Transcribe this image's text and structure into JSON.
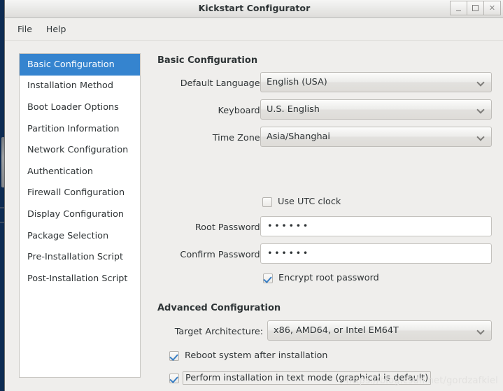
{
  "window": {
    "title": "Kickstart Configurator",
    "buttons": {
      "minimize": "_",
      "maximize": "□",
      "close": "✕"
    }
  },
  "menubar": {
    "items": [
      {
        "label": "File"
      },
      {
        "label": "Help"
      }
    ]
  },
  "sidebar": {
    "items": [
      {
        "label": "Basic Configuration",
        "selected": true
      },
      {
        "label": "Installation Method",
        "selected": false
      },
      {
        "label": "Boot Loader Options",
        "selected": false
      },
      {
        "label": "Partition Information",
        "selected": false
      },
      {
        "label": "Network Configuration",
        "selected": false
      },
      {
        "label": "Authentication",
        "selected": false
      },
      {
        "label": "Firewall Configuration",
        "selected": false
      },
      {
        "label": "Display Configuration",
        "selected": false
      },
      {
        "label": "Package Selection",
        "selected": false
      },
      {
        "label": "Pre-Installation Script",
        "selected": false
      },
      {
        "label": "Post-Installation Script",
        "selected": false
      }
    ]
  },
  "basic": {
    "heading": "Basic Configuration",
    "language_label": "Default Language:",
    "language_value": "English (USA)",
    "keyboard_label": "Keyboard:",
    "keyboard_value": "U.S. English",
    "timezone_label": "Time Zone:",
    "timezone_value": "Asia/Shanghai",
    "utc_label": "Use UTC clock",
    "utc_checked": false,
    "root_password_label": "Root Password:",
    "root_password_value": "••••••",
    "confirm_password_label": "Confirm Password:",
    "confirm_password_value": "••••••",
    "encrypt_label": "Encrypt root password",
    "encrypt_checked": true
  },
  "advanced": {
    "heading": "Advanced Configuration",
    "arch_label": "Target Architecture:",
    "arch_value": "x86, AMD64, or Intel EM64T",
    "reboot_label": "Reboot system after installation",
    "reboot_checked": true,
    "textmode_label": "Perform installation in text mode (graphical is default)",
    "textmode_checked": true
  },
  "watermark": {
    "text": "https://blog.csdn.net/gordzafkiel"
  },
  "colors": {
    "selection_blue": "#3584cf",
    "desktop_navy": "#0d2b52",
    "window_bg": "#efeeec",
    "check_blue": "#3a7fc4"
  }
}
